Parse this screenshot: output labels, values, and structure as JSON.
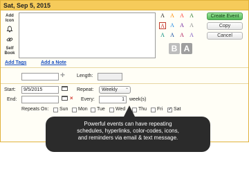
{
  "header": {
    "date": "Sat, Sep 5, 2015"
  },
  "tools": {
    "add_icon_label": "Add Icon",
    "self_book_label": "Self Book"
  },
  "text_swatches": {
    "glyph": "A",
    "colors": [
      "#222222",
      "#ff8c00",
      "#ff3b30",
      "#2e7d32",
      "#1e88e5",
      "#6a1b9a",
      "#c62828",
      "#8e8e8e",
      "#00897b",
      "#0d47a1",
      "#ad1457",
      "#7e57c2"
    ],
    "selected_index": 4,
    "big_glyphs": [
      "B",
      "A"
    ],
    "big_colors": [
      "#bdbdbd",
      "#9e9e9e"
    ]
  },
  "actions": {
    "create": "Create Event",
    "copy": "Copy",
    "cancel": "Cancel"
  },
  "links": {
    "add_tags": "Add Tags",
    "add_note": "Add a Note"
  },
  "length": {
    "label": "Length:",
    "value": ""
  },
  "icons": {
    "plus": "plus-icon",
    "calendar": "calendar-icon",
    "clear": "close-icon",
    "bell": "bell-icon",
    "link": "link-icon"
  },
  "schedule": {
    "start_label": "Start:",
    "start_value": "9/5/2015",
    "end_label": "End:",
    "end_value": "",
    "repeat_label": "Repeat:",
    "repeat_value": "Weekly",
    "every_label": "Every:",
    "every_value": "1",
    "every_unit": "week(s)",
    "repeats_on_label": "Repeats On:",
    "days": [
      {
        "label": "Sun",
        "checked": false
      },
      {
        "label": "Mon",
        "checked": false
      },
      {
        "label": "Tue",
        "checked": false
      },
      {
        "label": "Wed",
        "checked": false
      },
      {
        "label": "Thu",
        "checked": false
      },
      {
        "label": "Fri",
        "checked": false
      },
      {
        "label": "Sat",
        "checked": true
      }
    ]
  },
  "tooltip": {
    "lines": [
      "Powerful events can have repeating",
      "schedules, hyperlinks, color-codes, icons,",
      "and reminders via email & text message."
    ]
  }
}
